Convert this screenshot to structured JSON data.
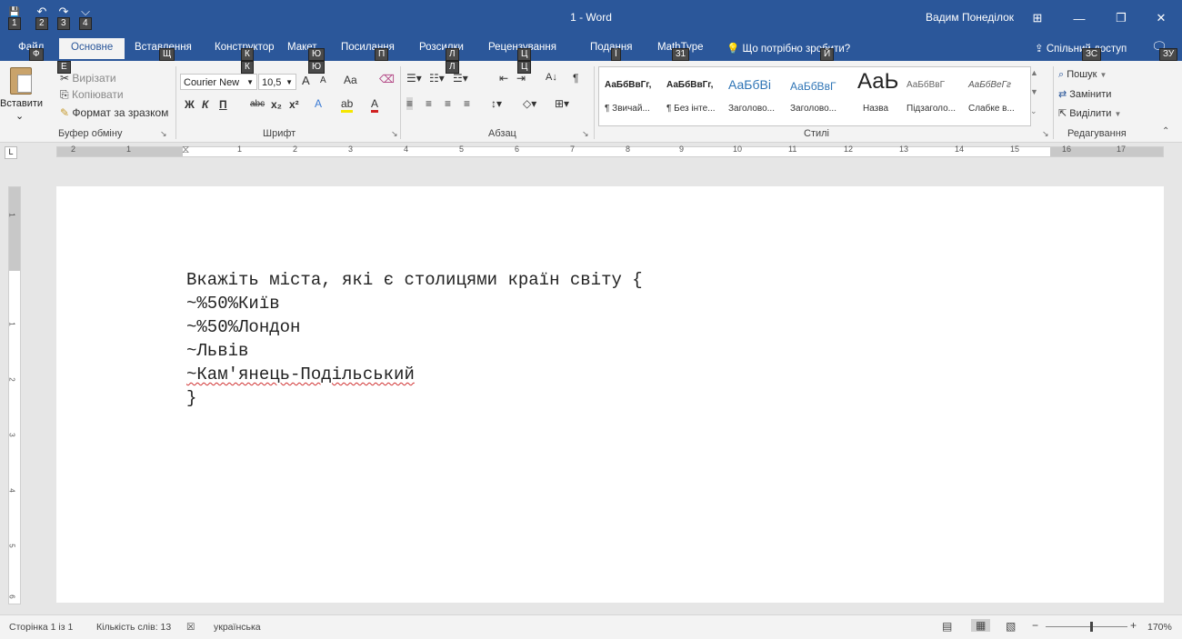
{
  "window": {
    "title": "1 - Word",
    "user": "Вадим Понеділок",
    "controls": {
      "display_options": "⊞",
      "minimize": "—",
      "restore": "❐",
      "close": "✕"
    },
    "qat": {
      "save": "💾",
      "undo": "↶",
      "redo": "↷",
      "customize": "⌵"
    }
  },
  "keytips": {
    "qat": [
      "1",
      "2",
      "3",
      "4"
    ],
    "file": "Ф",
    "insert": "Щ",
    "design": "К",
    "layout": "Ю",
    "references": "П",
    "mailings": "Л",
    "review": "Ц",
    "view": "Ї",
    "mathtype": "31",
    "tell_me": "Й",
    "share": "ЗС",
    "comments": "ЗУ",
    "home": "E"
  },
  "tabs": {
    "file": "Файл",
    "home": "Основне",
    "insert": "Вставлення",
    "design": "Конструктор",
    "layout": "Макет",
    "references": "Посилання",
    "mailings": "Розсилки",
    "review": "Рецензування",
    "view": "Подання",
    "mathtype": "MathType",
    "tell_me": "Що потрібно зробити?",
    "share": "Спільний доступ"
  },
  "clipboard": {
    "label": "Буфер обміну",
    "paste": "Вставити",
    "cut": "Вирізати",
    "copy": "Копіювати",
    "format_painter": "Формат за зразком"
  },
  "font": {
    "label": "Шрифт",
    "font_name": "Courier New",
    "font_size": "10,5",
    "grow": "A",
    "shrink": "A",
    "change_case": "Aa",
    "bold": "Ж",
    "italic": "К",
    "underline": "П",
    "strike": "abc",
    "subscript": "x₂",
    "superscript": "x²",
    "text_effects": "A",
    "highlight": "ab",
    "font_color": "A"
  },
  "paragraph": {
    "label": "Абзац",
    "show_marks": "¶",
    "sort": "A↓"
  },
  "styles": {
    "label": "Стилі",
    "items": [
      {
        "sample": "АаБбВвГг,",
        "name": "¶ Звичай..."
      },
      {
        "sample": "АаБбВвГг,",
        "name": "¶ Без інте..."
      },
      {
        "sample": "АаБбВі",
        "name": "Заголово..."
      },
      {
        "sample": "АаБбВвГ",
        "name": "Заголово..."
      },
      {
        "sample": "АаЬ",
        "name": "Назва"
      },
      {
        "sample": "АаБбВвГ",
        "name": "Підзаголо..."
      },
      {
        "sample": "АаБбВеГг",
        "name": "Слабке в..."
      }
    ]
  },
  "editing": {
    "label": "Редагування",
    "find": "Пошук",
    "replace": "Замінити",
    "select": "Виділити"
  },
  "ruler": {
    "numbers": [
      "2",
      "1",
      "1",
      "2",
      "3",
      "4",
      "5",
      "6",
      "7",
      "8",
      "9",
      "10",
      "11",
      "12",
      "13",
      "14",
      "15",
      "16",
      "17"
    ],
    "vnumbers": [
      "1",
      "1",
      "2",
      "3",
      "4",
      "5",
      "6"
    ]
  },
  "document": {
    "lines": [
      "Вкажіть міста, які є столицями країн світу {",
      "~%50%Київ",
      "~%50%Лондон",
      "~Львів",
      "~Кам'янець-Подільський",
      "}"
    ]
  },
  "status": {
    "page": "Сторінка 1 із 1",
    "words": "Кількість слів: 13",
    "language": "українська",
    "zoom": "170%",
    "zoom_minus": "−",
    "zoom_plus": "+"
  },
  "colors": {
    "accent": "#2b579a",
    "ribbon": "#f3f3f3",
    "canvas": "#e6e6e6"
  }
}
